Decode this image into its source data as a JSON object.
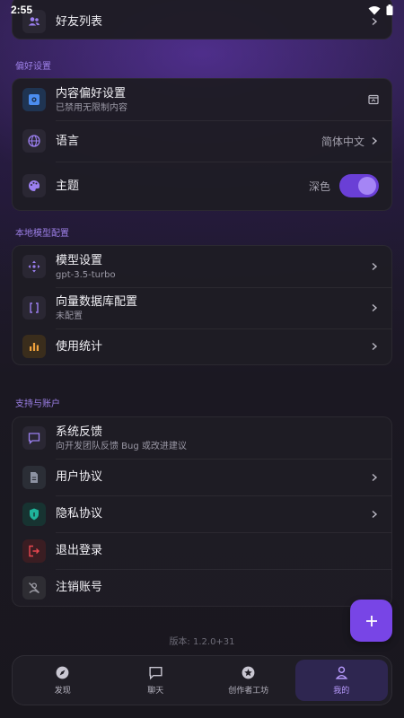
{
  "status_bar": {
    "time": "2:55"
  },
  "friends_card": {
    "title": "好友列表"
  },
  "sections": {
    "preferences": "偏好设置",
    "local_model": "本地模型配置",
    "support": "支持与账户"
  },
  "preferences": {
    "content_pref": {
      "title": "内容偏好设置",
      "subtitle": "已禁用无限制内容"
    },
    "language": {
      "title": "语言",
      "value": "简体中文"
    },
    "theme": {
      "title": "主题",
      "value": "深色",
      "enabled": true
    }
  },
  "local_model": {
    "model_settings": {
      "title": "模型设置",
      "subtitle": "gpt-3.5-turbo"
    },
    "vector_db": {
      "title": "向量数据库配置",
      "subtitle": "未配置"
    },
    "usage_stats": {
      "title": "使用统计"
    }
  },
  "support": {
    "feedback": {
      "title": "系统反馈",
      "subtitle": "向开发团队反馈 Bug 或改进建议"
    },
    "user_agreement": {
      "title": "用户协议"
    },
    "privacy_policy": {
      "title": "隐私协议"
    },
    "logout": {
      "title": "退出登录"
    },
    "delete_account": {
      "title": "注销账号"
    }
  },
  "fab": {
    "label": "+"
  },
  "version": "版本: 1.2.0+31",
  "bottom_nav": [
    {
      "label": "发现"
    },
    {
      "label": "聊天"
    },
    {
      "label": "创作者工坊"
    },
    {
      "label": "我的"
    }
  ],
  "colors": {
    "accent": "#7845e6",
    "section_title": "#9c7fe6",
    "card_bg": "#1e1c24"
  }
}
